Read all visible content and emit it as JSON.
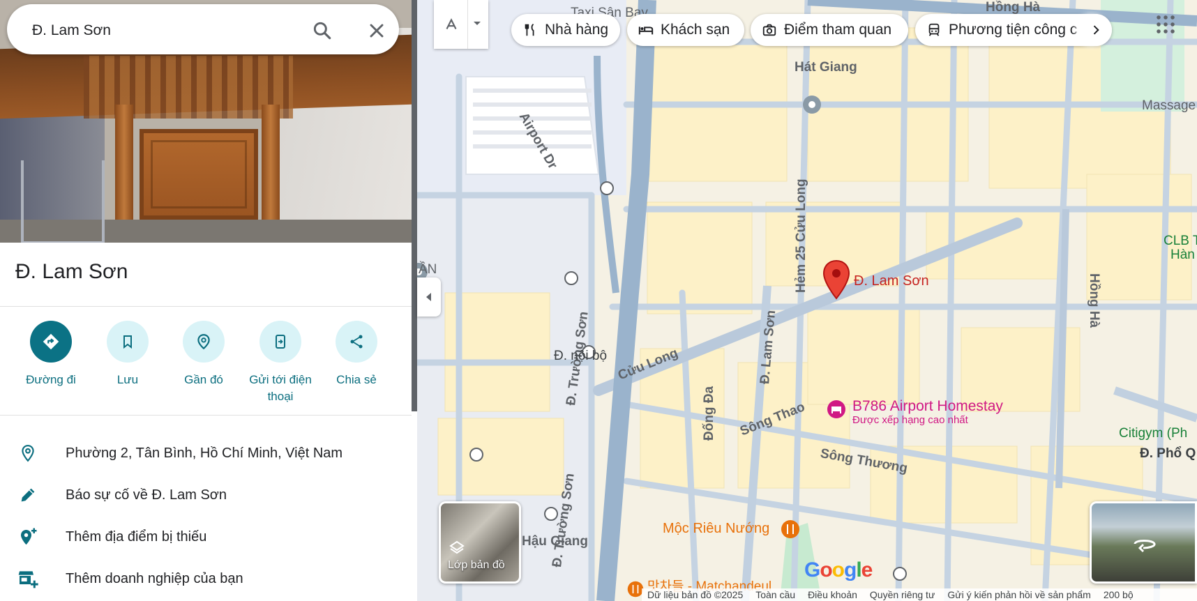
{
  "search": {
    "value": "Đ. Lam Sơn"
  },
  "place": {
    "title": "Đ. Lam Sơn"
  },
  "actions": [
    {
      "label": "Đường đi"
    },
    {
      "label": "Lưu"
    },
    {
      "label": "Gần đó"
    },
    {
      "label": "Gửi tới điện thoại"
    },
    {
      "label": "Chia sẻ"
    }
  ],
  "info": [
    {
      "icon": "location-pin-icon",
      "text": "Phường 2, Tân Bình, Hồ Chí Minh, Việt Nam"
    },
    {
      "icon": "pencil-icon",
      "text": "Báo sự cố về Đ. Lam Sơn"
    },
    {
      "icon": "add-location-icon",
      "text": "Thêm địa điểm bị thiếu"
    },
    {
      "icon": "add-business-icon",
      "text": "Thêm doanh nghiệp của bạn"
    }
  ],
  "chips": [
    {
      "icon": "restaurant-icon",
      "label": "Nhà hàng"
    },
    {
      "icon": "hotel-icon",
      "label": "Khách sạn"
    },
    {
      "icon": "camera-icon",
      "label": "Điểm tham quan"
    },
    {
      "icon": "transit-icon",
      "label": "Phương tiện công c"
    }
  ],
  "map_labels": {
    "hat_giang": "Hát Giang",
    "massage": "Massage & Spa - YUBII",
    "airport_dr": "Airport Dr",
    "hem25": "Hẻm 25 Cửu Long",
    "pin": "Đ. Lam Sơn",
    "truong_son_1": "Đ. Trường Sơn",
    "truong_son_2": "Đ. Trường Sơn",
    "noi_bo": "Đ. nội bộ",
    "cuu_long": "Cửu Long",
    "lam_son_street": "Đ. Lam Sơn",
    "song_thao": "Sông Thao",
    "dong_da": "Đống Đa",
    "song_thuong": "Sông Thương",
    "homestay_title": "B786 Airport Homestay",
    "homestay_sub": "Được xếp hạng cao nhất",
    "moc_rieu": "Mộc Riêu Nướng",
    "hau_giang": "Hậu Giang",
    "matchandeul": "맛차들 - Matchandeul",
    "hong_ha_top": "Hồng Hà",
    "hong_ha_right": "Hồng Hà",
    "taxi": "Taxi Sân Bay",
    "clb": "CLB T",
    "han": "Hàn",
    "citigym": "Citigym (Ph",
    "pho_q": "Đ. Phổ Q",
    "an_partial": "ẦN"
  },
  "layers_label": "Lớp bản đồ",
  "google_logo": "Google",
  "footer": {
    "data": "Dữ liệu bản đồ ©2025",
    "global": "Toàn cầu",
    "terms": "Điều khoản",
    "privacy": "Quyền riêng tư",
    "feedback": "Gửi ý kiến phản hồi về sản phẩm",
    "scale": "200 bộ"
  },
  "colors": {
    "accent": "#0b7285",
    "pin": "#ea4335",
    "homestay": "#d01884",
    "food": "#e8710a",
    "road_major": "#9ab3cc",
    "road_minor": "#c7d3df",
    "block": "#fdf3cf"
  }
}
